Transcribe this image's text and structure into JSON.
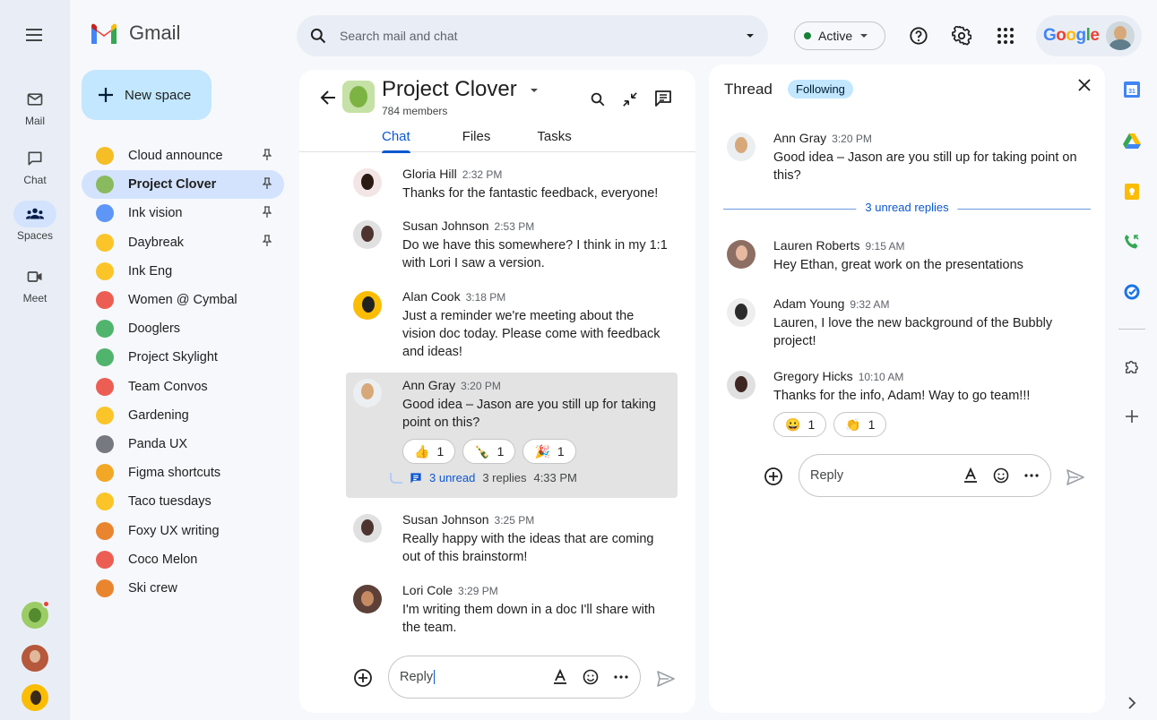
{
  "app": {
    "name": "Gmail"
  },
  "search": {
    "placeholder": "Search mail and chat"
  },
  "status": {
    "label": "Active",
    "color": "#188038"
  },
  "account": {
    "brand": "Google"
  },
  "rail": [
    {
      "label": "Mail",
      "icon": "mail-icon"
    },
    {
      "label": "Chat",
      "icon": "chat-icon"
    },
    {
      "label": "Spaces",
      "icon": "spaces-icon",
      "active": true
    },
    {
      "label": "Meet",
      "icon": "meet-icon"
    }
  ],
  "new_space": {
    "label": "New space"
  },
  "spaces": [
    {
      "name": "Cloud announce",
      "pinned": true,
      "color": "#f4b400"
    },
    {
      "name": "Project Clover",
      "pinned": true,
      "selected": true,
      "color": "#7cb342"
    },
    {
      "name": "Ink vision",
      "pinned": true,
      "color": "#4285f4"
    },
    {
      "name": "Daybreak",
      "pinned": true,
      "color": "#fbbc04"
    },
    {
      "name": "Ink Eng",
      "color": "#fbbc04"
    },
    {
      "name": "Women @ Cymbal",
      "color": "#ea4335"
    },
    {
      "name": "Dooglers",
      "color": "#34a853"
    },
    {
      "name": "Project Skylight",
      "color": "#34a853"
    },
    {
      "name": "Team Convos",
      "color": "#ea4335"
    },
    {
      "name": "Gardening",
      "color": "#fbbc04"
    },
    {
      "name": "Panda UX",
      "color": "#5f6368"
    },
    {
      "name": "Figma shortcuts",
      "color": "#f29900"
    },
    {
      "name": "Taco tuesdays",
      "color": "#fbbc04"
    },
    {
      "name": "Foxy UX writing",
      "color": "#e8710a"
    },
    {
      "name": "Coco Melon",
      "color": "#ea4335"
    },
    {
      "name": "Ski crew",
      "color": "#e8710a"
    }
  ],
  "chat": {
    "title": "Project Clover",
    "members": "784 members",
    "tabs": [
      "Chat",
      "Files",
      "Tasks"
    ],
    "messages": [
      {
        "name": "Gloria Hill",
        "time": "2:32 PM",
        "text": "Thanks for the fantastic feedback, everyone!"
      },
      {
        "name": "Susan Johnson",
        "time": "2:53 PM",
        "text": "Do we have this somewhere? I think in my 1:1 with Lori I saw a version."
      },
      {
        "name": "Alan Cook",
        "time": "3:18 PM",
        "text": "Just a reminder we're meeting about the vision doc today. Please come with feedback and ideas!"
      },
      {
        "name": "Ann Gray",
        "time": "3:20 PM",
        "text": "Good idea – Jason are you still up for taking point on this?",
        "reactions": [
          {
            "emoji": "👍",
            "count": "1"
          },
          {
            "emoji": "🍾",
            "count": "1"
          },
          {
            "emoji": "🎉",
            "count": "1"
          }
        ],
        "thread": {
          "unread": "3 unread",
          "replies": "3 replies",
          "time": "4:33 PM"
        }
      },
      {
        "name": "Susan Johnson",
        "time": "3:25 PM",
        "text": "Really happy with the ideas that are coming out of this brainstorm!"
      },
      {
        "name": "Lori Cole",
        "time": "3:29 PM",
        "text": "I'm writing them down in a doc I'll share with the team."
      }
    ],
    "reply_placeholder": "Reply"
  },
  "thread": {
    "title": "Thread",
    "following": "Following",
    "root": {
      "name": "Ann Gray",
      "time": "3:20 PM",
      "text": "Good idea – Jason are you still up for taking point on this?"
    },
    "unread_divider": "3 unread replies",
    "replies": [
      {
        "name": "Lauren Roberts",
        "time": "9:15 AM",
        "text": "Hey Ethan, great work on the presentations"
      },
      {
        "name": "Adam Young",
        "time": "9:32 AM",
        "text": "Lauren, I love the new background of the Bubbly project!"
      },
      {
        "name": "Gregory Hicks",
        "time": "10:10 AM",
        "text": "Thanks for the info, Adam! Way to go team!!!",
        "reactions": [
          {
            "emoji": "😀",
            "count": "1"
          },
          {
            "emoji": "👏",
            "count": "1"
          }
        ]
      }
    ],
    "reply_placeholder": "Reply"
  }
}
